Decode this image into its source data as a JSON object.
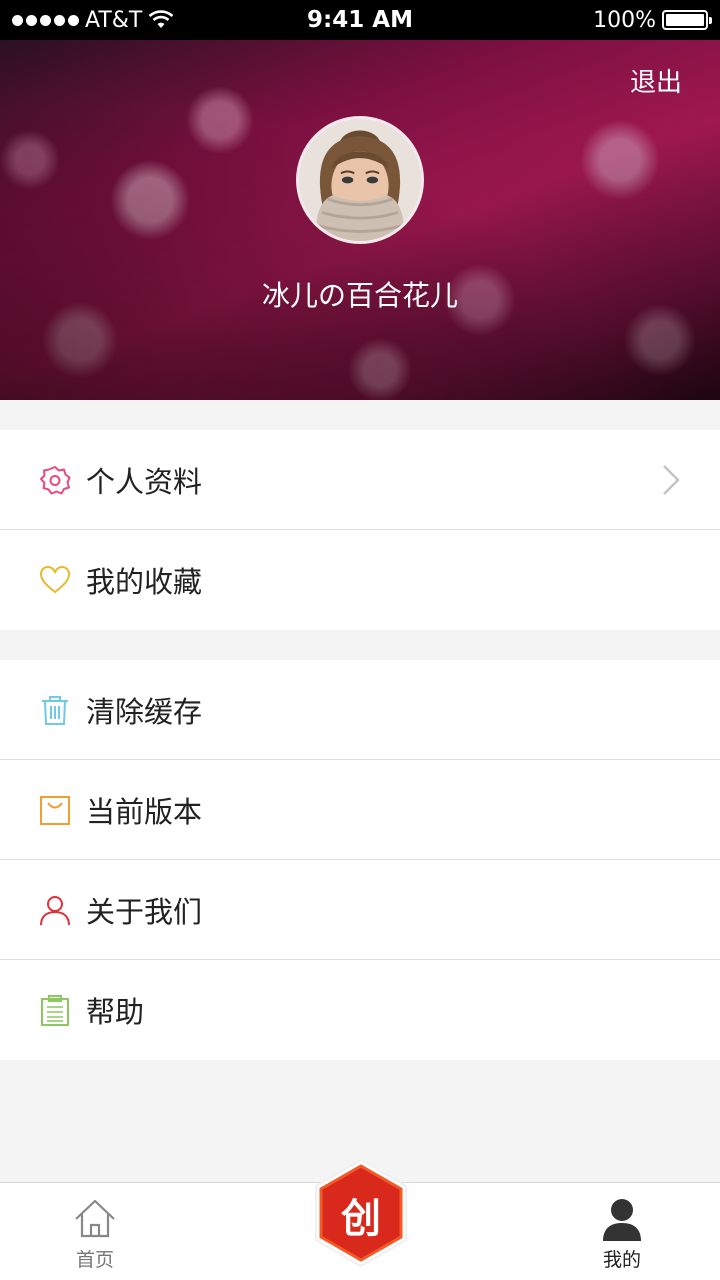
{
  "status_bar": {
    "carrier": "AT&T",
    "time": "9:41 AM",
    "battery": "100%"
  },
  "header": {
    "logout_label": "退出",
    "username": "冰儿の百合花儿",
    "avatar": "user-avatar-photo"
  },
  "menu_group_1": [
    {
      "label": "个人资料",
      "icon": "gear-flower-icon",
      "color": "#e84a7a",
      "chevron": true
    },
    {
      "label": "我的收藏",
      "icon": "heart-icon",
      "color": "#e8b92a",
      "chevron": false
    }
  ],
  "menu_group_2": [
    {
      "label": "清除缓存",
      "icon": "trash-icon",
      "color": "#6ec9ea"
    },
    {
      "label": "当前版本",
      "icon": "bag-icon",
      "color": "#f0a030"
    },
    {
      "label": "关于我们",
      "icon": "person-icon",
      "color": "#e0303a"
    },
    {
      "label": "帮助",
      "icon": "clipboard-icon",
      "color": "#8cc860"
    }
  ],
  "tabbar": {
    "home_label": "首页",
    "center_label": "创",
    "mine_label": "我的",
    "center_color": "#d9281c"
  }
}
